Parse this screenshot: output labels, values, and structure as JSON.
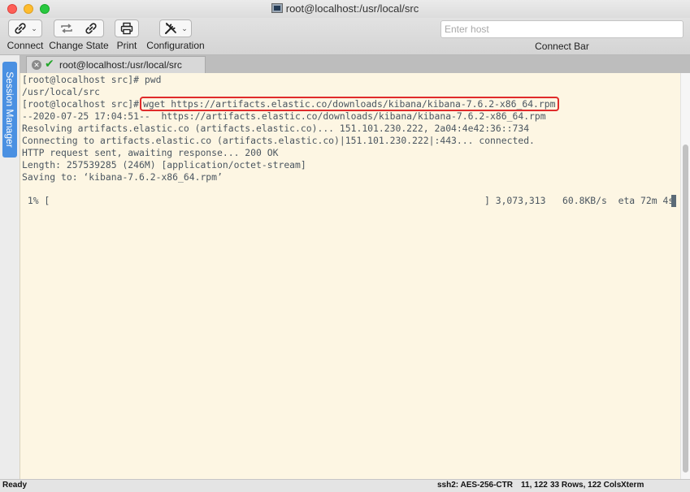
{
  "window": {
    "title": "root@localhost:/usr/local/src"
  },
  "toolbar": {
    "connect_label": "Connect",
    "change_state_label": "Change State",
    "print_label": "Print",
    "configuration_label": "Configuration",
    "host_placeholder": "Enter host",
    "host_value": "",
    "connect_bar_label": "Connect Bar"
  },
  "side": {
    "session_manager_label": "Session Manager"
  },
  "tabs": [
    {
      "label": "root@localhost:/usr/local/src",
      "status": "connected"
    }
  ],
  "terminal": {
    "lines": [
      "[root@localhost src]# pwd",
      "/usr/local/src",
      "[root@localhost src]#",
      "--2020-07-25 17:04:51--  https://artifacts.elastic.co/downloads/kibana/kibana-7.6.2-x86_64.rpm",
      "Resolving artifacts.elastic.co (artifacts.elastic.co)... 151.101.230.222, 2a04:4e42:36::734",
      "Connecting to artifacts.elastic.co (artifacts.elastic.co)|151.101.230.222|:443... connected.",
      "HTTP request sent, awaiting response... 200 OK",
      "Length: 257539285 (246M) [application/octet-stream]",
      "Saving to: ‘kibana-7.6.2-x86_64.rpm’"
    ],
    "highlighted_command": "wget https://artifacts.elastic.co/downloads/kibana/kibana-7.6.2-x86_64.rpm",
    "progress_left": " 1% [",
    "progress_right": "] 3,073,313   60.8KB/s  eta 72m 4s",
    "progress_percent": 1
  },
  "status": {
    "state": "Ready",
    "cipher": "ssh2: AES-256-CTR",
    "cursor_pos": "11, 122",
    "size": "33 Rows, 122 Cols",
    "term_type": "Xterm"
  },
  "colors": {
    "terminal_bg": "#fdf6e3",
    "terminal_fg": "#4b5660",
    "highlight_border": "#e02b2b",
    "session_tab": "#4a90e2"
  }
}
